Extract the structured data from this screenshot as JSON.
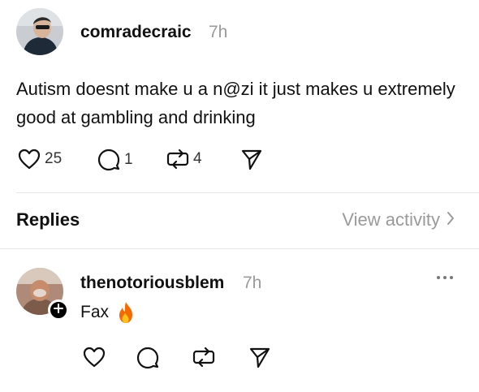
{
  "post": {
    "username": "comradecraic",
    "timestamp": "7h",
    "text": "Autism doesnt make u a n@zi it just makes u extremely good at gambling and drinking",
    "likes": "25",
    "comments": "1",
    "reposts": "4"
  },
  "replies_header": {
    "label": "Replies",
    "view_activity": "View activity"
  },
  "reply": {
    "username": "thenotoriousblem",
    "timestamp": "7h",
    "text": "Fax"
  },
  "icons": {
    "like": "heart-icon",
    "comment": "comment-icon",
    "repost": "repost-icon",
    "share": "send-icon",
    "more": "more-icon",
    "follow": "plus-icon",
    "emoji": "fire-icon"
  },
  "colors": {
    "text": "#111111",
    "muted": "#9a9a9a",
    "divider": "#e6e6e6",
    "background": "#ffffff"
  }
}
